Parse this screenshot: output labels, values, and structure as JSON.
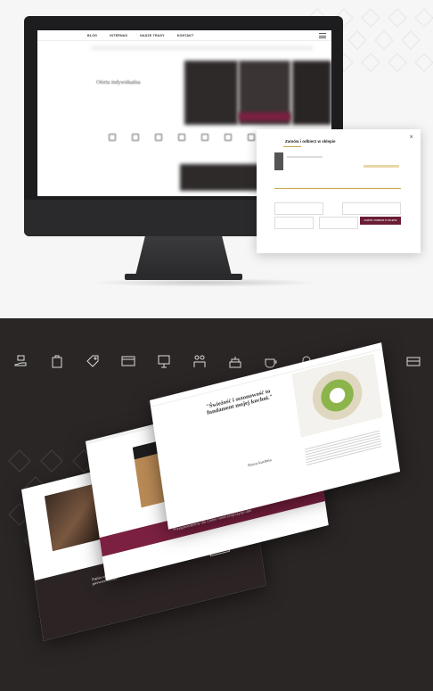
{
  "top": {
    "nav": [
      "BLOG",
      "INTERNAS",
      "NASZE TRASY",
      "KONTAKT"
    ],
    "hero_title": "Oferta indywidualna",
    "modal": {
      "title": "Zamów i odbierz w sklepie",
      "cta": "ZAMÓW I ODBIERZ W SKLEPIE"
    }
  },
  "bottom": {
    "icons": [
      "cup-hand-icon",
      "bag-icon",
      "tag-icon",
      "card-icon",
      "presentation-icon",
      "family-icon",
      "cake-icon",
      "coffee-cup-icon",
      "bell-icon",
      "champagne-tower-icon",
      "corkscrew-icon",
      "gift-card-icon"
    ],
    "sheet_c": {
      "quote": "\"Świeżość i sezonowość to fundament mojej kuchni.\"",
      "section": "Nasza kuchnia"
    },
    "sheet_b": {
      "band": "Przygotowaliśmy dla Ciebie nowe propozycje dań"
    },
    "sheet_a": {
      "newsletter": "Zapisz się do newslettera i skorzystaj ze zniżki na pierwsze zakupy!",
      "button": "ZAPISZ"
    }
  },
  "colors": {
    "wine": "#7b2040",
    "gold": "#c9a64a",
    "dark_bg": "#2b2626"
  }
}
